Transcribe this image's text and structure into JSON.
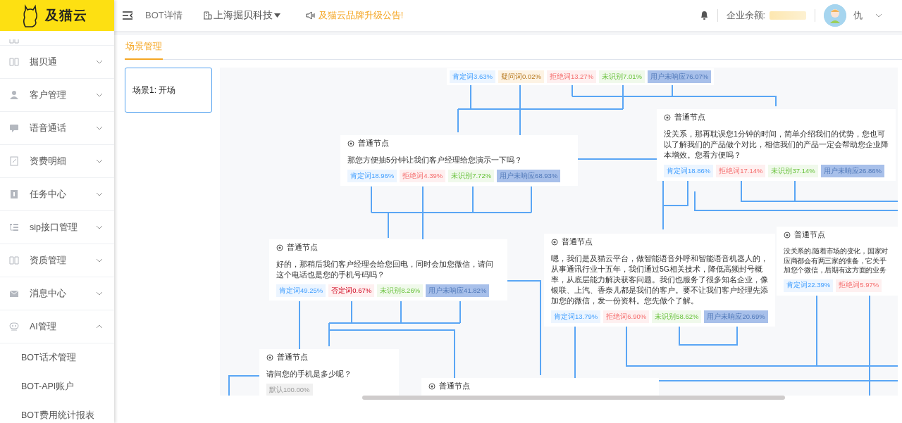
{
  "logo": {
    "text": "及猫云"
  },
  "sidebar": {
    "items": [
      {
        "label": "掘贝通",
        "expanded": false
      },
      {
        "label": "客户管理",
        "expanded": false
      },
      {
        "label": "语音通话",
        "expanded": false
      },
      {
        "label": "资费明细",
        "expanded": false
      },
      {
        "label": "任务中心",
        "expanded": false
      },
      {
        "label": "sip接口管理",
        "expanded": false
      },
      {
        "label": "资质管理",
        "expanded": false
      },
      {
        "label": "消息中心",
        "expanded": false
      },
      {
        "label": "AI管理",
        "expanded": true,
        "children": [
          {
            "label": "BOT话术管理"
          },
          {
            "label": "BOT-API账户"
          },
          {
            "label": "BOT费用统计报表"
          }
        ]
      }
    ]
  },
  "topbar": {
    "page_title": "BOT详情",
    "company": "上海掘贝科技",
    "notice": "及猫云品牌升级公告!",
    "balance_label": "企业余额:",
    "user": "仇"
  },
  "tabs": [
    {
      "label": "场景管理",
      "selected": true
    }
  ],
  "scenes": [
    {
      "label": "场景1: 开场",
      "selected": true
    }
  ],
  "canvas": {
    "nodes": [
      {
        "kind": "tags-only",
        "tags": [
          {
            "label": "肯定词3.63%",
            "kind": "positive"
          },
          {
            "label": "疑问词0.02%",
            "kind": "question"
          },
          {
            "label": "拒绝词13.27%",
            "kind": "reject"
          },
          {
            "label": "未识别7.01%",
            "kind": "unknown"
          },
          {
            "label": "用户未响应76.07%",
            "kind": "silent"
          }
        ]
      },
      {
        "kind": "normal",
        "header": "普通节点",
        "text": "那您方便抽5分钟让我们客户经理给您演示一下吗？",
        "tags": [
          {
            "label": "肯定词18.96%",
            "kind": "positive"
          },
          {
            "label": "拒绝词4.39%",
            "kind": "reject"
          },
          {
            "label": "未识别7.72%",
            "kind": "unknown"
          },
          {
            "label": "用户未响应68.93%",
            "kind": "silent"
          }
        ]
      },
      {
        "kind": "normal",
        "header": "普通节点",
        "text": "没关系，那再耽误您1分钟的时间，简单介绍我们的优势，您也可以了解我们的产品做个对比，相信我们的产品一定会帮助您企业降本增效。您看方便吗？",
        "tags": [
          {
            "label": "肯定词18.86%",
            "kind": "positive"
          },
          {
            "label": "拒绝词17.14%",
            "kind": "reject"
          },
          {
            "label": "未识别37.14%",
            "kind": "unknown"
          },
          {
            "label": "用户未响应26.86%",
            "kind": "silent"
          }
        ]
      },
      {
        "kind": "normal",
        "header": "普通节点",
        "text": "好的，那稍后我们客户经理会给您回电，同时会加您微信，请问这个电话也是您的手机号码吗？",
        "tags": [
          {
            "label": "肯定词49.25%",
            "kind": "positive"
          },
          {
            "label": "否定词0.67%",
            "kind": "negative"
          },
          {
            "label": "未识别8.26%",
            "kind": "unknown"
          },
          {
            "label": "用户未响应41.82%",
            "kind": "silent"
          }
        ]
      },
      {
        "kind": "normal",
        "header": "普通节点",
        "text": "嗯，我们是及猫云平台，做智能语音外呼和智能语音机器人的，从事通讯行业十五年，我们通过5G相关技术，降低高频封号概率，从底层能力解决获客问题。我们也服务了很多知名企业，像银联、上汽、香奈儿都是我们的客户。要不让我们客户经理先添加您的微信，发一份资料。您先做个了解。",
        "tags": [
          {
            "label": "肯定词13.79%",
            "kind": "positive"
          },
          {
            "label": "拒绝词6.90%",
            "kind": "reject"
          },
          {
            "label": "未识别58.62%",
            "kind": "unknown"
          },
          {
            "label": "用户未响应20.69%",
            "kind": "silent"
          }
        ]
      },
      {
        "kind": "normal",
        "header": "普通节点",
        "lines": [
          "没关系的.随着市场的变化，国家对",
          "应商都会有两三家的准备，它关乎",
          "加您个微信，后期有这方面的业务"
        ],
        "tags": [
          {
            "label": "肯定词22.39%",
            "kind": "positive"
          },
          {
            "label": "拒绝词5.97%",
            "kind": "reject"
          }
        ]
      },
      {
        "kind": "normal",
        "header": "普通节点",
        "text": "请问您的手机是多少呢？",
        "tags": [
          {
            "label": "默认100.00%",
            "kind": "default"
          }
        ]
      },
      {
        "kind": "normal",
        "header": "普通节点"
      }
    ]
  }
}
